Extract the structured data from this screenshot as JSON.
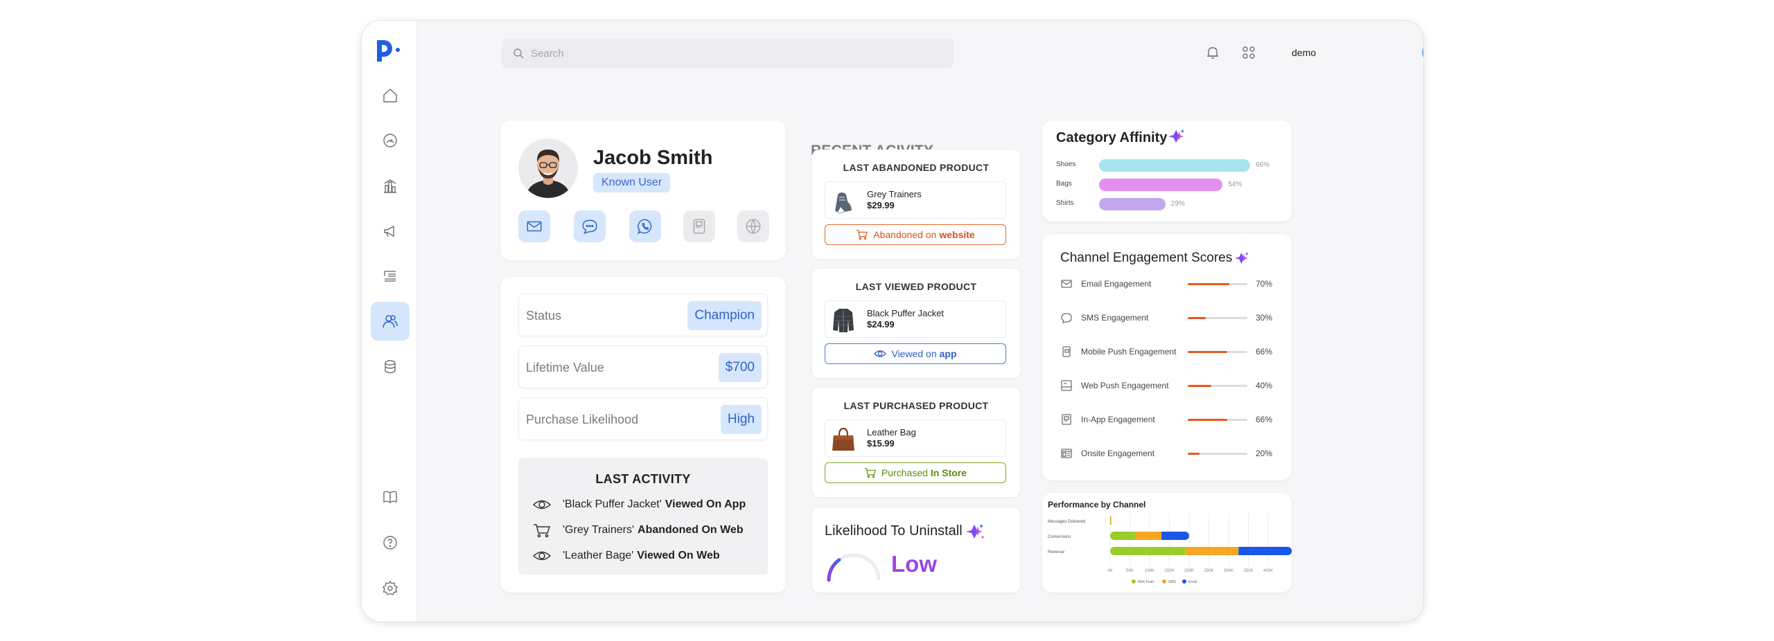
{
  "topbar": {
    "search_placeholder": "Search",
    "username": "demo"
  },
  "profile": {
    "name": "Jacob Smith",
    "badge": "Known User",
    "channels": [
      "email",
      "sms",
      "whatsapp",
      "mobile-push",
      "web-push"
    ]
  },
  "stats": {
    "status_label": "Status",
    "status_value": "Champion",
    "ltv_label": "Lifetime Value",
    "ltv_value": "$700",
    "likelihood_label": "Purchase Likelihood",
    "likelihood_value": "High"
  },
  "last_activity": {
    "title": "LAST ACTIVITY",
    "items": [
      {
        "item": "'Black Puffer Jacket'",
        "action": "Viewed On App",
        "icon": "eye-icon"
      },
      {
        "item": "'Grey Trainers'",
        "action": "Abandoned On Web",
        "icon": "cart-icon"
      },
      {
        "item": "'Leather Bage'",
        "action": "Viewed On Web",
        "icon": "eye-icon"
      }
    ]
  },
  "recent_activity": {
    "title": "RECENT ACIVITY",
    "abandoned": {
      "heading": "LAST ABANDONED PRODUCT",
      "name": "Grey Trainers",
      "price": "$29.99",
      "action_prefix": "Abandoned on",
      "action_channel": "website"
    },
    "viewed": {
      "heading": "LAST VIEWED PRODUCT",
      "name": "Black Puffer Jacket",
      "price": "$24.99",
      "action_prefix": "Viewed on",
      "action_channel": "app"
    },
    "purchased": {
      "heading": "LAST PURCHASED PRODUCT",
      "name": "Leather Bag",
      "price": "$15.99",
      "action_prefix": "Purchased",
      "action_channel": "In Store"
    }
  },
  "uninstall": {
    "title": "Likelihood To Uninstall",
    "value": "Low",
    "level": 0.3
  },
  "category_affinity": {
    "title": "Category Affinity",
    "items": [
      {
        "label": "Shoes",
        "pct": "66%",
        "value": 66,
        "color": "#a6e3ef"
      },
      {
        "label": "Bags",
        "pct": "54%",
        "value": 54,
        "color": "#e58ff0"
      },
      {
        "label": "Shirts",
        "pct": "29%",
        "value": 29,
        "color": "#c3a8ef"
      }
    ]
  },
  "channel_engagement": {
    "title": "Channel Engagement Scores",
    "items": [
      {
        "label": "Email Engagement",
        "pct": "70%",
        "value": 70,
        "icon": "mail-icon"
      },
      {
        "label": "SMS Engagement",
        "pct": "30%",
        "value": 30,
        "icon": "sms-icon"
      },
      {
        "label": "Mobile Push Engagement",
        "pct": "66%",
        "value": 66,
        "icon": "mobile-push-icon"
      },
      {
        "label": "Web Push Engagement",
        "pct": "40%",
        "value": 40,
        "icon": "web-push-icon"
      },
      {
        "label": "In-App Engagement",
        "pct": "66%",
        "value": 66,
        "icon": "in-app-icon"
      },
      {
        "label": "Onsite Engagement",
        "pct": "20%",
        "value": 20,
        "icon": "onsite-icon"
      }
    ]
  },
  "chart_data": {
    "type": "bar",
    "orientation": "horizontal",
    "stacked": true,
    "title": "Performance by Channel",
    "categories": [
      "Messages Delivered",
      "Conversions",
      "Revenue"
    ],
    "x_ticks": [
      "0K",
      "50K",
      "100K",
      "150K",
      "200K",
      "250K",
      "300K",
      "350K",
      "400K"
    ],
    "xlim": [
      0,
      400000
    ],
    "series": [
      {
        "name": "Web Push",
        "color": "#9ccc2b",
        "values": [
          0,
          65000,
          190000
        ]
      },
      {
        "name": "SMS",
        "color": "#f5a623",
        "values": [
          3000,
          65000,
          135000
        ]
      },
      {
        "name": "Email",
        "color": "#1a56e8",
        "values": [
          0,
          70000,
          135000
        ]
      }
    ],
    "legend": "bottom",
    "grid": true
  }
}
